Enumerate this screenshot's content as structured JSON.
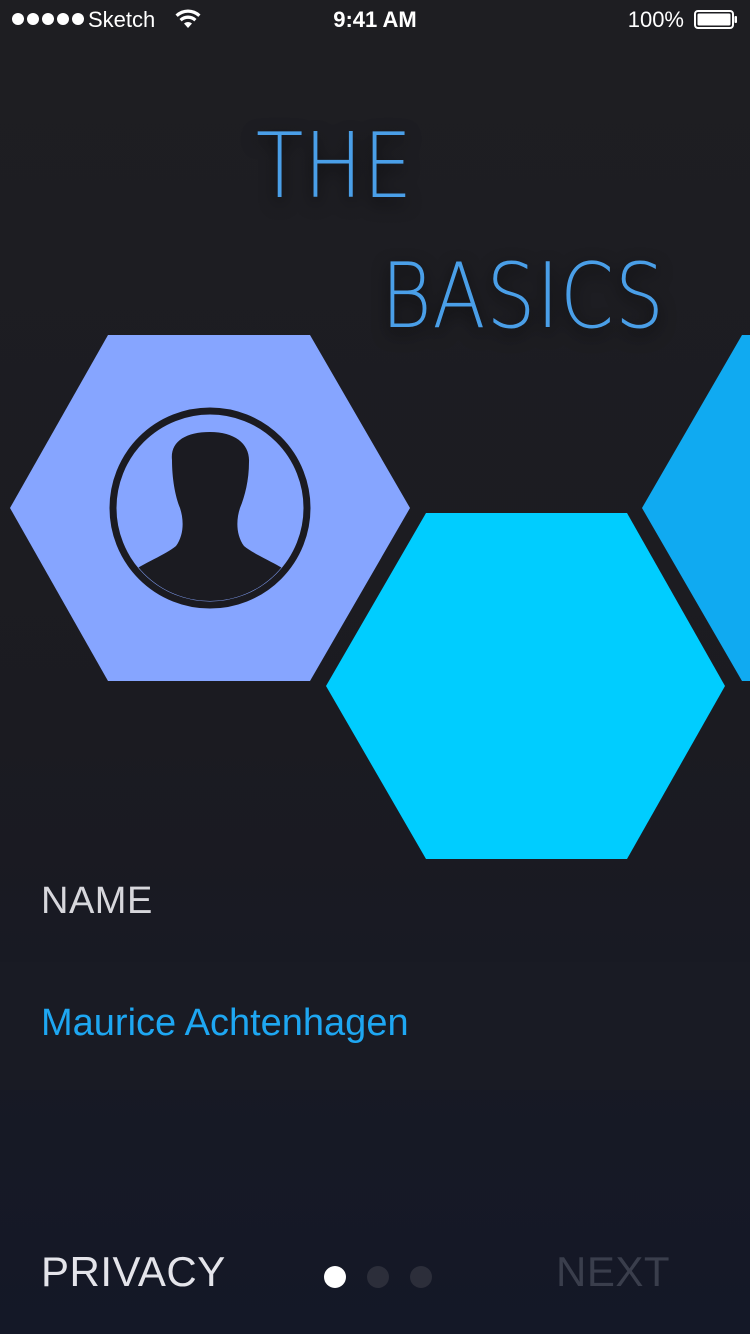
{
  "status_bar": {
    "carrier": "Sketch",
    "time": "9:41 AM",
    "battery_percent": "100%",
    "signal_bars": 5,
    "icons": [
      "signal-dots-icon",
      "wifi-icon",
      "battery-icon"
    ]
  },
  "header": {
    "title_line_1": "THE",
    "title_line_2": "BASICS"
  },
  "carousel": {
    "items": [
      {
        "icon": "user-avatar-icon",
        "color": "#86a5ff"
      },
      {
        "icon": "",
        "color": "#00cdff"
      },
      {
        "icon": "",
        "color": "#10aaf1"
      }
    ]
  },
  "form": {
    "name_label": "NAME",
    "name_value": "Maurice Achtenhagen"
  },
  "footer": {
    "privacy_label": "PRIVACY",
    "next_label": "NEXT",
    "page_count": 3,
    "current_page": 1
  },
  "colors": {
    "background": "#1d1d22",
    "title": "#4a9fe8",
    "name_value": "#1ea7f2",
    "hex_primary": "#86a5ff",
    "hex_secondary": "#00cdff",
    "hex_tertiary": "#10aaf1",
    "next_disabled": "#3a3e4c"
  }
}
